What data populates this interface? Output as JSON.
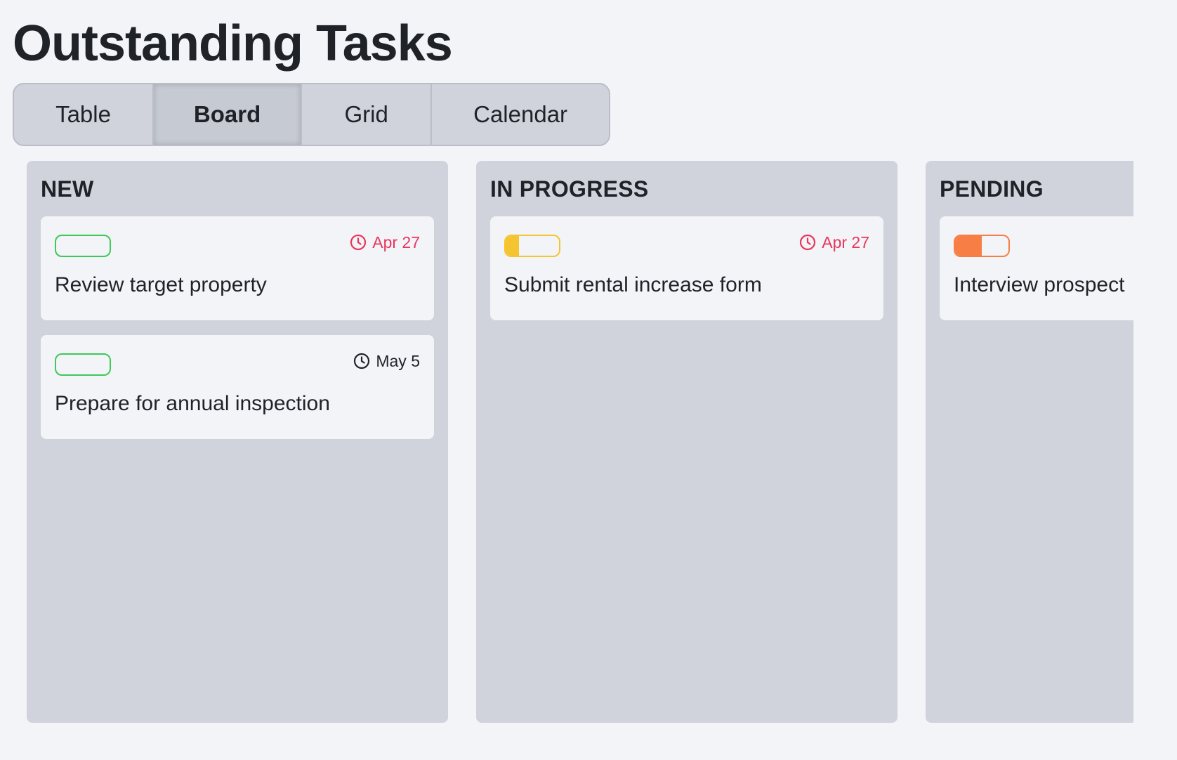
{
  "page": {
    "title": "Outstanding Tasks"
  },
  "tabs": [
    {
      "label": "Table",
      "active": false
    },
    {
      "label": "Board",
      "active": true
    },
    {
      "label": "Grid",
      "active": false
    },
    {
      "label": "Calendar",
      "active": false
    }
  ],
  "colors": {
    "overdue": "#e8365d",
    "normal_date": "#1f2328",
    "new": "#3ec95a",
    "in_progress": "#f5c531",
    "pending": "#f77f45"
  },
  "columns": [
    {
      "title": "NEW",
      "cards": [
        {
          "title": "Review target property",
          "due": "Apr 27",
          "overdue": true,
          "badge_color": "#3ec95a",
          "progress": 0,
          "icon": "clock-icon"
        },
        {
          "title": "Prepare for annual inspection",
          "due": "May 5",
          "overdue": false,
          "badge_color": "#3ec95a",
          "progress": 0,
          "icon": "clock-icon"
        }
      ]
    },
    {
      "title": "IN PROGRESS",
      "cards": [
        {
          "title": "Submit rental increase form",
          "due": "Apr 27",
          "overdue": true,
          "badge_color": "#f5c531",
          "progress": 0.25,
          "icon": "clock-icon"
        }
      ]
    },
    {
      "title": "PENDING",
      "cards": [
        {
          "title": "Interview prospect",
          "due": "",
          "overdue": false,
          "badge_color": "#f77f45",
          "progress": 0.5,
          "icon": "clock-icon"
        }
      ]
    }
  ]
}
